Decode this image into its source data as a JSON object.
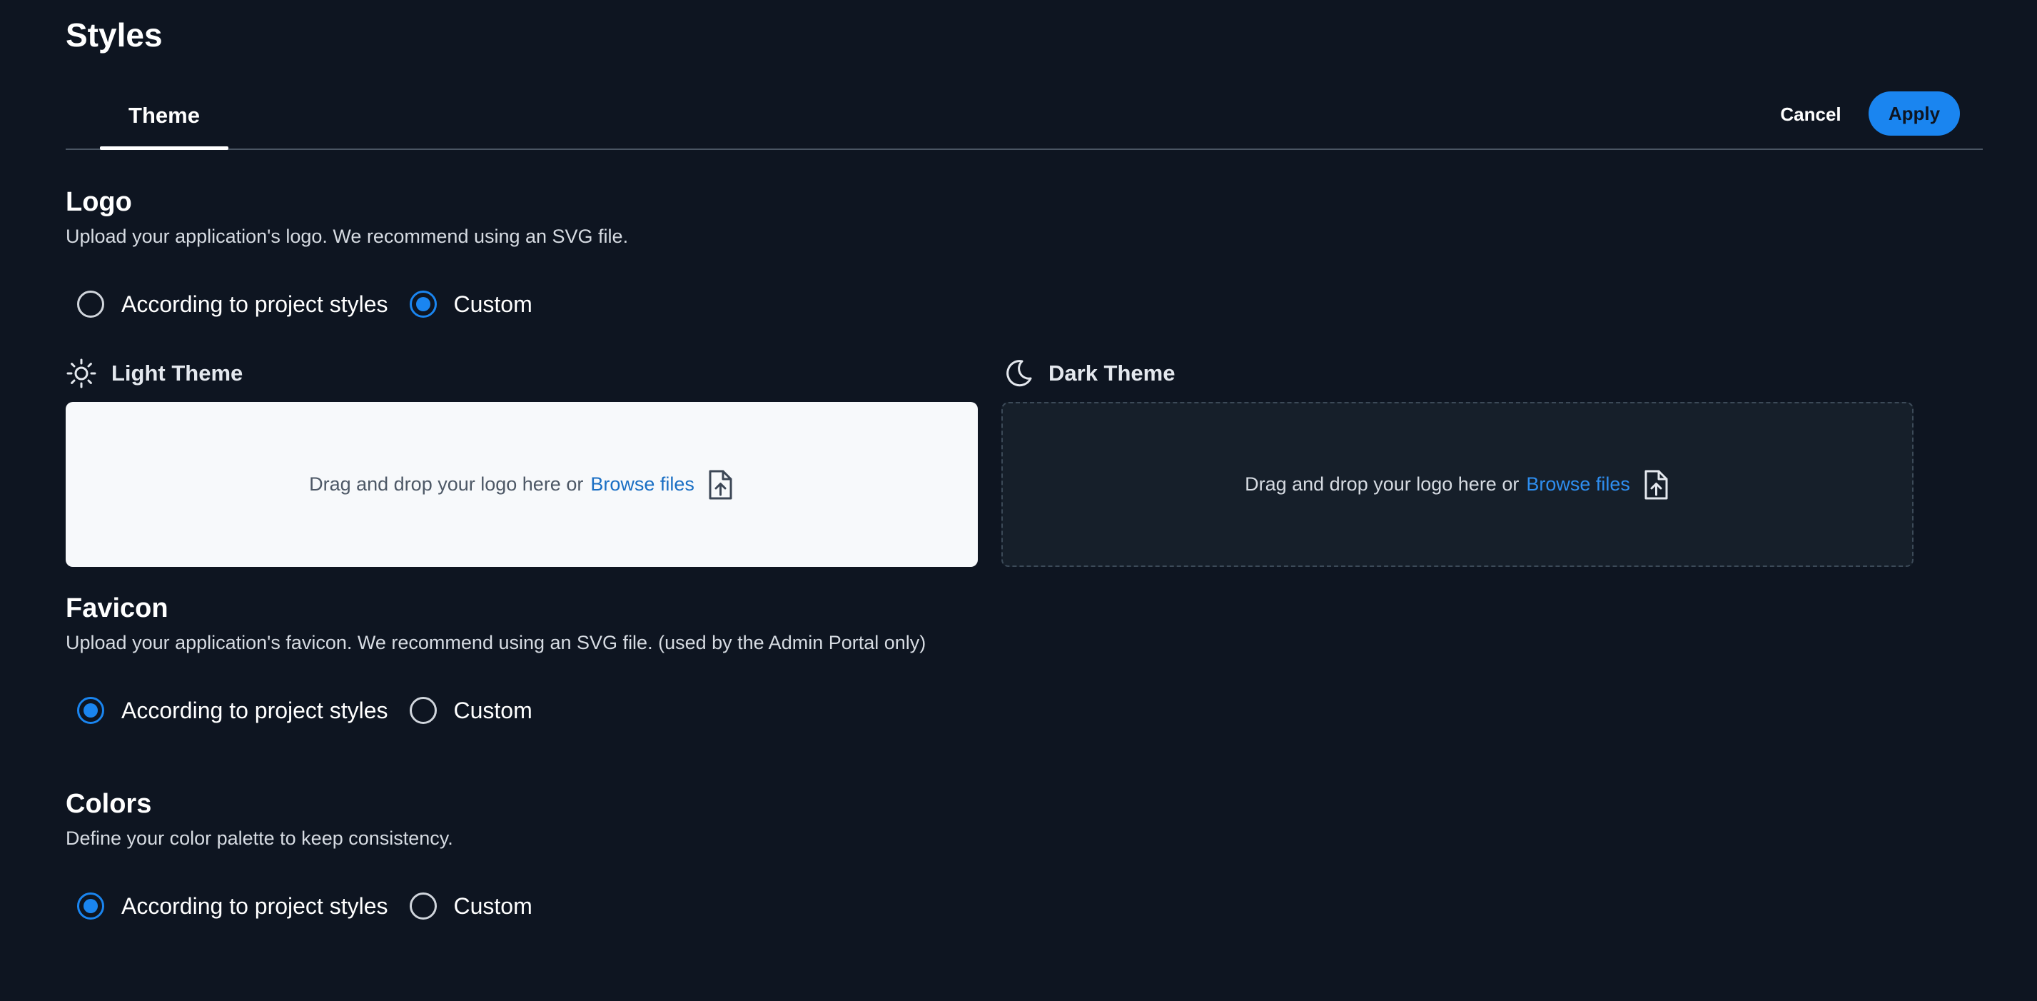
{
  "page": {
    "title": "Styles"
  },
  "tabs": [
    {
      "label": "Theme",
      "active": true
    }
  ],
  "actions": {
    "cancel_label": "Cancel",
    "apply_label": "Apply"
  },
  "logo": {
    "title": "Logo",
    "description": "Upload your application's logo. We recommend using an SVG file.",
    "options": [
      {
        "label": "According to project styles",
        "selected": false
      },
      {
        "label": "Custom",
        "selected": true
      }
    ],
    "light": {
      "label": "Light Theme",
      "drop_text": "Drag and drop your logo here or",
      "browse_label": "Browse files"
    },
    "dark": {
      "label": "Dark Theme",
      "drop_text": "Drag and drop your logo here or",
      "browse_label": "Browse files"
    }
  },
  "favicon": {
    "title": "Favicon",
    "description": "Upload your application's favicon. We recommend using an SVG file. (used by the Admin Portal only)",
    "options": [
      {
        "label": "According to project styles",
        "selected": true
      },
      {
        "label": "Custom",
        "selected": false
      }
    ]
  },
  "colors": {
    "title": "Colors",
    "description": "Define your color palette to keep consistency.",
    "options": [
      {
        "label": "According to project styles",
        "selected": true
      },
      {
        "label": "Custom",
        "selected": false
      }
    ]
  },
  "icons": {
    "light": "sun-icon",
    "dark": "moon-icon",
    "upload": "file-upload-icon"
  },
  "palette": {
    "background": "#0e1521",
    "accent": "#1a85f0",
    "dropzone_light": "#f7f9fb",
    "dropzone_dark": "#161f2a"
  }
}
